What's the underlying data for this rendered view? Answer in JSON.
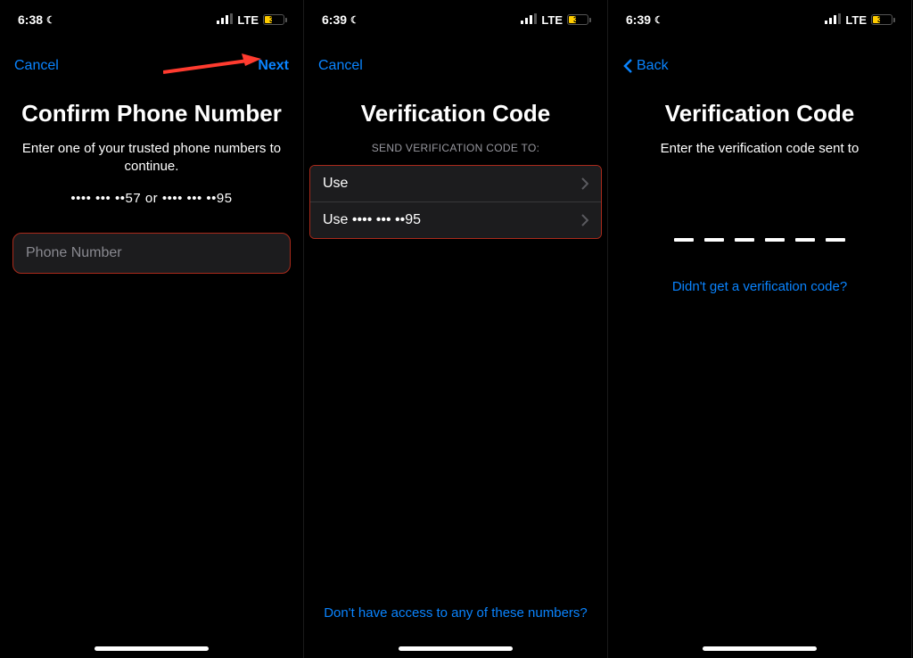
{
  "status": {
    "time1": "6:38",
    "time2": "6:39",
    "time3": "6:39",
    "network": "LTE",
    "battery": "38"
  },
  "screen1": {
    "nav_cancel": "Cancel",
    "nav_next": "Next",
    "title": "Confirm Phone Number",
    "subtitle": "Enter one of your trusted phone numbers to continue.",
    "masked": "•••• ••• ••57 or •••• ••• ••95",
    "placeholder": "Phone Number"
  },
  "screen2": {
    "nav_cancel": "Cancel",
    "title": "Verification Code",
    "section": "SEND VERIFICATION CODE TO:",
    "option1": "Use",
    "option2": "Use •••• ••• ••95",
    "bottom_link": "Don't have access to any of these numbers?"
  },
  "screen3": {
    "nav_back": "Back",
    "title": "Verification Code",
    "subtitle": "Enter the verification code sent to",
    "resend": "Didn't get a verification code?"
  }
}
